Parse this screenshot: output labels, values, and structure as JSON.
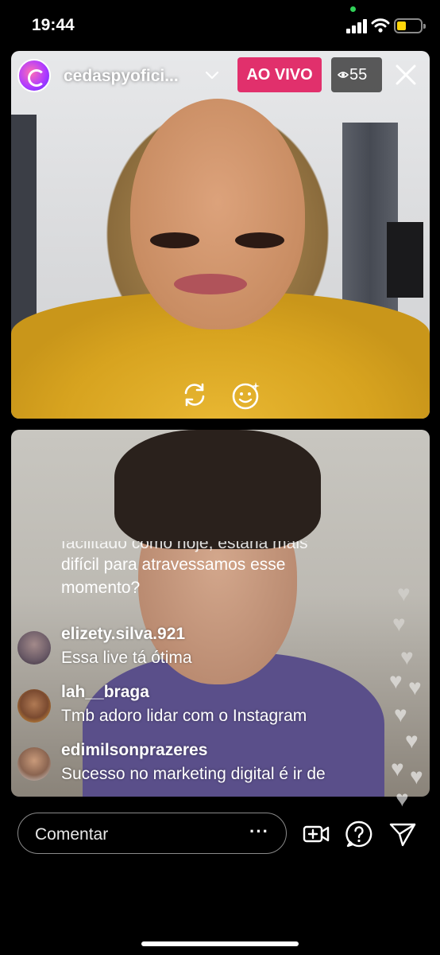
{
  "status_bar": {
    "time": "19:44"
  },
  "live": {
    "username": "cedaspyofici...",
    "badge": "AO VIVO",
    "viewer_count": "55"
  },
  "comments": {
    "partial_line_1": "facilitado como hoje, estaria mais",
    "partial_line_2": "difícil para atravessamos esse",
    "partial_line_3": "momento?",
    "items": [
      {
        "user": "elizety.silva.921",
        "text": "Essa live tá ótima"
      },
      {
        "user": "lah__braga",
        "text": "Tmb adoro lidar com o Instagram"
      },
      {
        "user": "edimilsonprazeres",
        "text": "Sucesso no marketing digital é ir de"
      }
    ]
  },
  "composer": {
    "placeholder": "Comentar",
    "more": "···"
  },
  "colors": {
    "live_badge": "#e1306c",
    "battery": "#ffd60a"
  },
  "icons": [
    "flip-camera-icon",
    "face-effects-icon",
    "close-icon",
    "video-add-icon",
    "question-icon",
    "send-icon",
    "heart-icon"
  ]
}
